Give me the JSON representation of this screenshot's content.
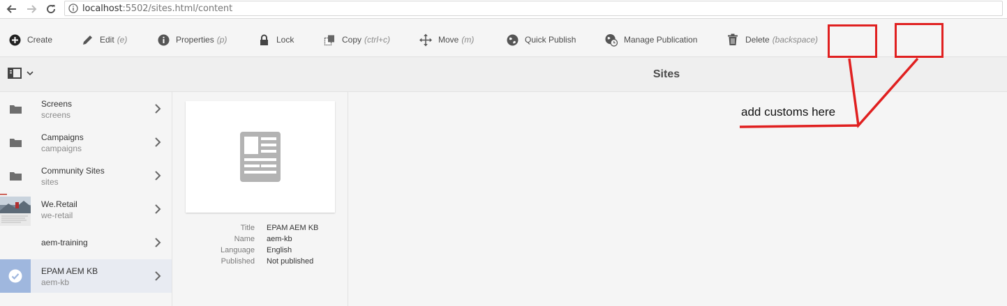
{
  "browser": {
    "url_host": "localhost",
    "url_path": ":5502/sites.html/content"
  },
  "actions": [
    {
      "label": "Create",
      "shortcut": "",
      "icon": "plus-circle-icon"
    },
    {
      "label": "Edit",
      "shortcut": "(e)",
      "icon": "pencil-icon"
    },
    {
      "label": "Properties",
      "shortcut": "(p)",
      "icon": "info-icon"
    },
    {
      "label": "Lock",
      "shortcut": "",
      "icon": "lock-icon"
    },
    {
      "label": "Copy",
      "shortcut": "(ctrl+c)",
      "icon": "copy-icon"
    },
    {
      "label": "Move",
      "shortcut": "(m)",
      "icon": "move-icon"
    },
    {
      "label": "Quick Publish",
      "shortcut": "",
      "icon": "globe-icon"
    },
    {
      "label": "Manage Publication",
      "shortcut": "",
      "icon": "globe-clock-icon"
    },
    {
      "label": "Delete",
      "shortcut": "(backspace)",
      "icon": "trash-icon"
    }
  ],
  "header": {
    "title": "Sites"
  },
  "column": {
    "items": [
      {
        "title": "Screens",
        "name": "screens",
        "thumb": "folder-icon"
      },
      {
        "title": "Campaigns",
        "name": "campaigns",
        "thumb": "folder-icon"
      },
      {
        "title": "Community Sites",
        "name": "sites",
        "thumb": "folder-icon"
      },
      {
        "title": "We.Retail",
        "name": "we-retail",
        "thumb": "photo-thumbnail"
      },
      {
        "title": "aem-training",
        "name": "",
        "thumb": "blank"
      },
      {
        "title": "EPAM AEM KB",
        "name": "aem-kb",
        "thumb": "check-circle-icon",
        "selected": true
      }
    ]
  },
  "details": {
    "rows": [
      {
        "label": "Title",
        "value": "EPAM AEM KB"
      },
      {
        "label": "Name",
        "value": "aem-kb"
      },
      {
        "label": "Language",
        "value": "English"
      },
      {
        "label": "Published",
        "value": "Not published"
      }
    ]
  },
  "annotation": {
    "text": "add customs here",
    "color": "#e02020"
  },
  "colors": {
    "accent_selected": "#9fb7de",
    "selected_row": "#e8ebf2"
  }
}
